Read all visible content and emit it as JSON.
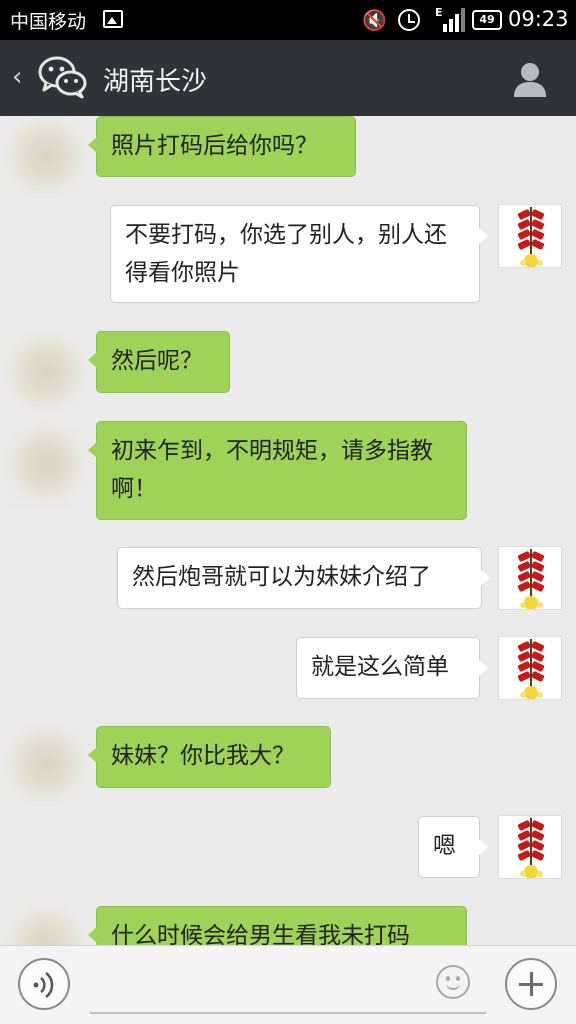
{
  "status_bar": {
    "carrier": "中国移动",
    "battery": "49",
    "time": "09:23",
    "signal_label": "E"
  },
  "header": {
    "title": "湖南长沙"
  },
  "messages": [
    {
      "side": "left",
      "text": "照片打码后给你吗？"
    },
    {
      "side": "right",
      "text": "不要打码，你选了别人，别人还得看你照片"
    },
    {
      "side": "left",
      "text": "然后呢？"
    },
    {
      "side": "left",
      "text": "初来乍到，不明规矩，请多指教啊！"
    },
    {
      "side": "right",
      "text": "然后炮哥就可以为妹妹介绍了"
    },
    {
      "side": "right",
      "text": "就是这么简单"
    },
    {
      "side": "left",
      "text": "妹妹？你比我大？"
    },
    {
      "side": "right",
      "text": "嗯"
    },
    {
      "side": "left",
      "text": "什么时候会给男生看我未打码"
    }
  ],
  "colors": {
    "left_bubble": "#9ed357",
    "right_bubble": "#ffffff",
    "title_bar": "#2f3337",
    "background": "#ebebeb"
  },
  "icons": {
    "back": "chevron-left-icon",
    "app": "wechat-icon",
    "contact": "person-icon",
    "voice": "voice-icon",
    "emoji": "smiley-icon",
    "more": "plus-icon",
    "right_avatar": "firecracker-avatar"
  }
}
